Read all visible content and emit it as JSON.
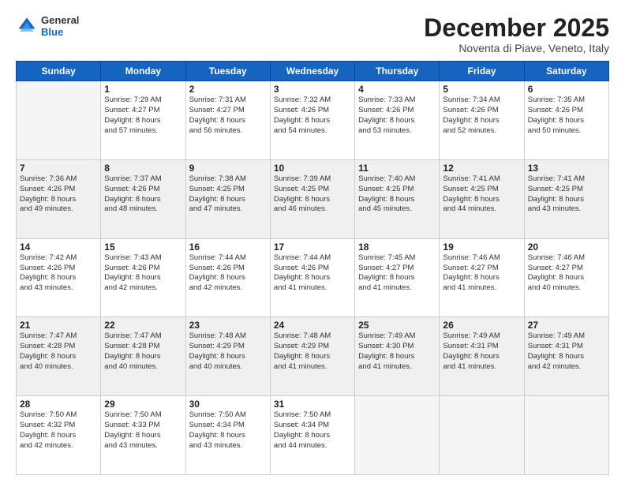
{
  "header": {
    "logo_line1": "General",
    "logo_line2": "Blue",
    "month": "December 2025",
    "location": "Noventa di Piave, Veneto, Italy"
  },
  "days_of_week": [
    "Sunday",
    "Monday",
    "Tuesday",
    "Wednesday",
    "Thursday",
    "Friday",
    "Saturday"
  ],
  "weeks": [
    [
      {
        "day": "",
        "info": ""
      },
      {
        "day": "1",
        "info": "Sunrise: 7:29 AM\nSunset: 4:27 PM\nDaylight: 8 hours\nand 57 minutes."
      },
      {
        "day": "2",
        "info": "Sunrise: 7:31 AM\nSunset: 4:27 PM\nDaylight: 8 hours\nand 56 minutes."
      },
      {
        "day": "3",
        "info": "Sunrise: 7:32 AM\nSunset: 4:26 PM\nDaylight: 8 hours\nand 54 minutes."
      },
      {
        "day": "4",
        "info": "Sunrise: 7:33 AM\nSunset: 4:26 PM\nDaylight: 8 hours\nand 53 minutes."
      },
      {
        "day": "5",
        "info": "Sunrise: 7:34 AM\nSunset: 4:26 PM\nDaylight: 8 hours\nand 52 minutes."
      },
      {
        "day": "6",
        "info": "Sunrise: 7:35 AM\nSunset: 4:26 PM\nDaylight: 8 hours\nand 50 minutes."
      }
    ],
    [
      {
        "day": "7",
        "info": "Sunrise: 7:36 AM\nSunset: 4:26 PM\nDaylight: 8 hours\nand 49 minutes."
      },
      {
        "day": "8",
        "info": "Sunrise: 7:37 AM\nSunset: 4:26 PM\nDaylight: 8 hours\nand 48 minutes."
      },
      {
        "day": "9",
        "info": "Sunrise: 7:38 AM\nSunset: 4:25 PM\nDaylight: 8 hours\nand 47 minutes."
      },
      {
        "day": "10",
        "info": "Sunrise: 7:39 AM\nSunset: 4:25 PM\nDaylight: 8 hours\nand 46 minutes."
      },
      {
        "day": "11",
        "info": "Sunrise: 7:40 AM\nSunset: 4:25 PM\nDaylight: 8 hours\nand 45 minutes."
      },
      {
        "day": "12",
        "info": "Sunrise: 7:41 AM\nSunset: 4:25 PM\nDaylight: 8 hours\nand 44 minutes."
      },
      {
        "day": "13",
        "info": "Sunrise: 7:41 AM\nSunset: 4:25 PM\nDaylight: 8 hours\nand 43 minutes."
      }
    ],
    [
      {
        "day": "14",
        "info": "Sunrise: 7:42 AM\nSunset: 4:26 PM\nDaylight: 8 hours\nand 43 minutes."
      },
      {
        "day": "15",
        "info": "Sunrise: 7:43 AM\nSunset: 4:26 PM\nDaylight: 8 hours\nand 42 minutes."
      },
      {
        "day": "16",
        "info": "Sunrise: 7:44 AM\nSunset: 4:26 PM\nDaylight: 8 hours\nand 42 minutes."
      },
      {
        "day": "17",
        "info": "Sunrise: 7:44 AM\nSunset: 4:26 PM\nDaylight: 8 hours\nand 41 minutes."
      },
      {
        "day": "18",
        "info": "Sunrise: 7:45 AM\nSunset: 4:27 PM\nDaylight: 8 hours\nand 41 minutes."
      },
      {
        "day": "19",
        "info": "Sunrise: 7:46 AM\nSunset: 4:27 PM\nDaylight: 8 hours\nand 41 minutes."
      },
      {
        "day": "20",
        "info": "Sunrise: 7:46 AM\nSunset: 4:27 PM\nDaylight: 8 hours\nand 40 minutes."
      }
    ],
    [
      {
        "day": "21",
        "info": "Sunrise: 7:47 AM\nSunset: 4:28 PM\nDaylight: 8 hours\nand 40 minutes."
      },
      {
        "day": "22",
        "info": "Sunrise: 7:47 AM\nSunset: 4:28 PM\nDaylight: 8 hours\nand 40 minutes."
      },
      {
        "day": "23",
        "info": "Sunrise: 7:48 AM\nSunset: 4:29 PM\nDaylight: 8 hours\nand 40 minutes."
      },
      {
        "day": "24",
        "info": "Sunrise: 7:48 AM\nSunset: 4:29 PM\nDaylight: 8 hours\nand 41 minutes."
      },
      {
        "day": "25",
        "info": "Sunrise: 7:49 AM\nSunset: 4:30 PM\nDaylight: 8 hours\nand 41 minutes."
      },
      {
        "day": "26",
        "info": "Sunrise: 7:49 AM\nSunset: 4:31 PM\nDaylight: 8 hours\nand 41 minutes."
      },
      {
        "day": "27",
        "info": "Sunrise: 7:49 AM\nSunset: 4:31 PM\nDaylight: 8 hours\nand 42 minutes."
      }
    ],
    [
      {
        "day": "28",
        "info": "Sunrise: 7:50 AM\nSunset: 4:32 PM\nDaylight: 8 hours\nand 42 minutes."
      },
      {
        "day": "29",
        "info": "Sunrise: 7:50 AM\nSunset: 4:33 PM\nDaylight: 8 hours\nand 43 minutes."
      },
      {
        "day": "30",
        "info": "Sunrise: 7:50 AM\nSunset: 4:34 PM\nDaylight: 8 hours\nand 43 minutes."
      },
      {
        "day": "31",
        "info": "Sunrise: 7:50 AM\nSunset: 4:34 PM\nDaylight: 8 hours\nand 44 minutes."
      },
      {
        "day": "",
        "info": ""
      },
      {
        "day": "",
        "info": ""
      },
      {
        "day": "",
        "info": ""
      }
    ]
  ]
}
